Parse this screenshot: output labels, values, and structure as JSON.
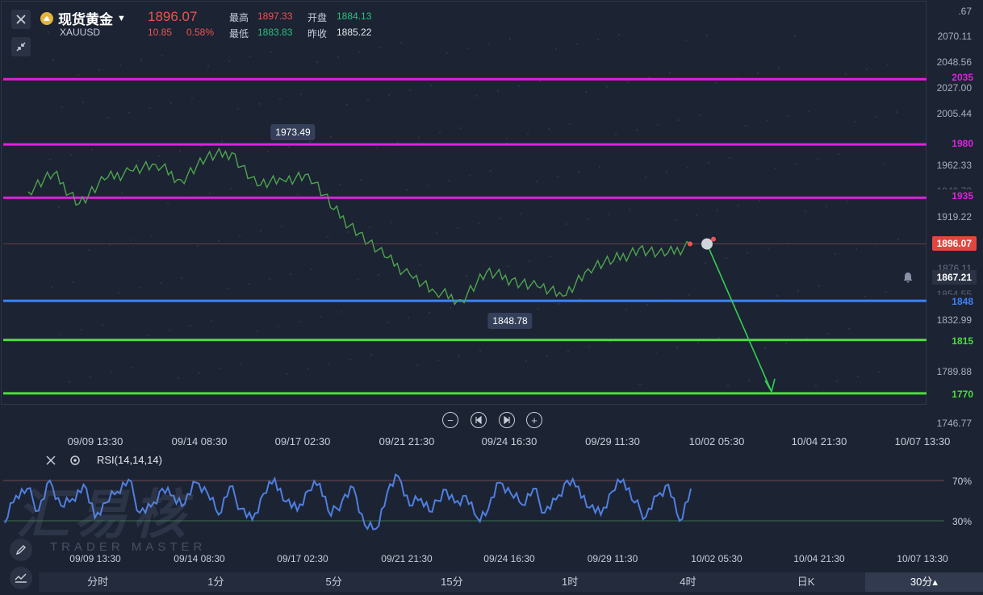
{
  "instrument": {
    "name": "现货黄金",
    "symbol": "XAUUSD",
    "price": "1896.07",
    "change": "10.85",
    "change_pct": "0.58%",
    "high_label": "最高",
    "high": "1897.33",
    "open_label": "开盘",
    "open": "1884.13",
    "low_label": "最低",
    "low": "1883.83",
    "prev_close_label": "昨收",
    "prev_close": "1885.22"
  },
  "colors": {
    "up": "#ef5350",
    "down": "#26c281",
    "resistance": "#e020e0",
    "support_blue": "#3b82f6",
    "support_green": "#4ade3a",
    "rsi_line": "#4f7fe0",
    "price_line": "#4ea44e"
  },
  "y_axis": {
    "labels": [
      ".67",
      "2070.11",
      "2048.56",
      "2027.00",
      "2005.44",
      "1962.33",
      "1940.78",
      "1919.22",
      "1876.11",
      "1854.55",
      "1832.99",
      "1789.88",
      "1746.77"
    ]
  },
  "current_price_tag": "1896.07",
  "alert_price": "1867.21",
  "levels": [
    {
      "label": "2035",
      "kind": "resistance"
    },
    {
      "label": "1980",
      "kind": "resistance"
    },
    {
      "label": "1935",
      "kind": "resistance"
    },
    {
      "label": "1848",
      "kind": "support_blue"
    },
    {
      "label": "1815",
      "kind": "support_green"
    },
    {
      "label": "1770",
      "kind": "support_green"
    }
  ],
  "annotations": {
    "high_mark": "1973.49",
    "low_mark": "1848.78"
  },
  "x_axis": {
    "labels": [
      "09/09 13:30",
      "09/14 08:30",
      "09/17 02:30",
      "09/21 21:30",
      "09/24 16:30",
      "09/29 11:30",
      "10/02 05:30",
      "10/04 21:30",
      "10/07 13:30"
    ]
  },
  "rsi": {
    "label": "RSI(14,14,14)",
    "level_high": "70%",
    "level_low": "30%"
  },
  "watermark": {
    "big": "汇易核",
    "small": "TRADER MASTER"
  },
  "timeframes": [
    "分时",
    "1分",
    "5分",
    "15分",
    "1时",
    "4时",
    "日K",
    "30分▴"
  ],
  "active_timeframe_index": 7,
  "chart_data": {
    "type": "line",
    "title": "现货黄金 XAUUSD",
    "x": [
      "09/09 13:30",
      "09/14 08:30",
      "09/17 02:30",
      "09/21 21:30",
      "09/24 16:30",
      "09/29 11:30",
      "10/02 05:30"
    ],
    "series": [
      {
        "name": "XAUUSD",
        "values": [
          1940,
          1955,
          1930,
          1950,
          1958,
          1963,
          1950,
          1969,
          1973,
          1945,
          1950,
          1955,
          1925,
          1905,
          1885,
          1870,
          1855,
          1849,
          1872,
          1866,
          1860,
          1852,
          1875,
          1882,
          1892,
          1886,
          1896
        ]
      }
    ],
    "levels": [
      2035,
      1980,
      1935,
      1848,
      1815,
      1770
    ],
    "projection": {
      "from": 1896,
      "to": 1770
    },
    "ylim": [
      1735,
      2080
    ],
    "rsi_ylim": [
      0,
      100
    ],
    "rsi_values": [
      28,
      55,
      62,
      40,
      70,
      45,
      52,
      66,
      33,
      48,
      59,
      71,
      38,
      44,
      62,
      55,
      47,
      68,
      58,
      36,
      64,
      42,
      31,
      57,
      72,
      49,
      40,
      60,
      67,
      35,
      50,
      63,
      26,
      22,
      58,
      74,
      45,
      52,
      39,
      61,
      48,
      55,
      33,
      42,
      68,
      57,
      46,
      62,
      38,
      51,
      70,
      64,
      43,
      36,
      59,
      71,
      48,
      34,
      55,
      66,
      30,
      62
    ]
  }
}
